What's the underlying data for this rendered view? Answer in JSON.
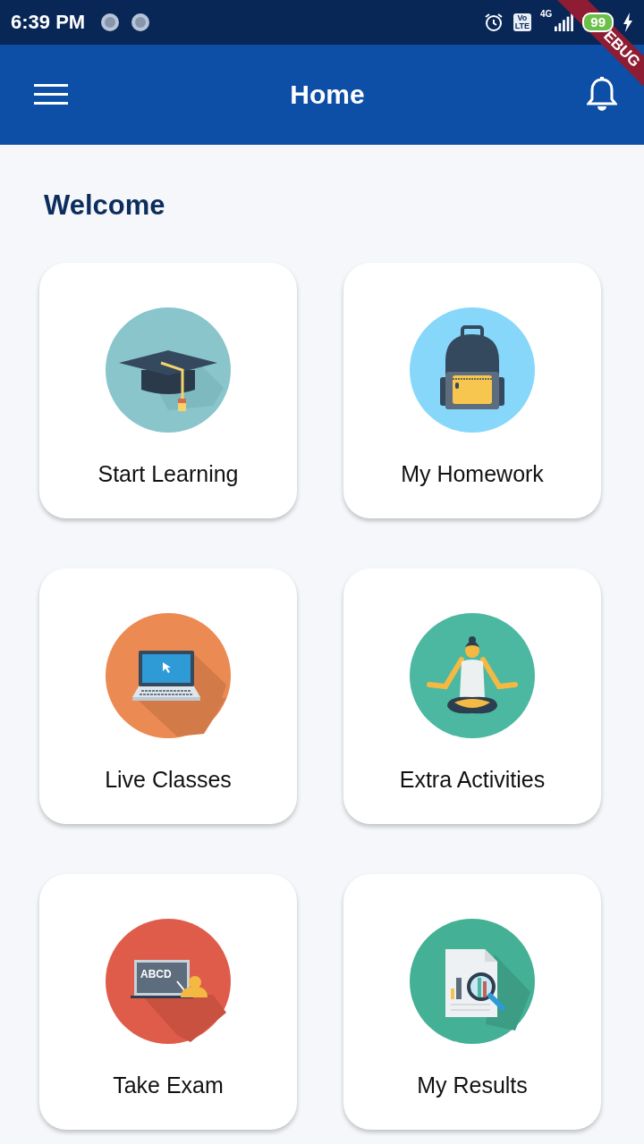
{
  "status_bar": {
    "time": "6:39 PM",
    "volte": [
      "Vo",
      "LTE"
    ],
    "network": "4G",
    "battery": "99",
    "banner": "EBUG"
  },
  "app_bar": {
    "title": "Home"
  },
  "welcome": "Welcome",
  "tiles": [
    {
      "label": "Start Learning",
      "kind": "graduation",
      "color": "#8ac5cc"
    },
    {
      "label": "My Homework",
      "kind": "backpack",
      "color": "#87d7fb"
    },
    {
      "label": "Live Classes",
      "kind": "laptop",
      "color": "#eb8a52"
    },
    {
      "label": "Extra Activities",
      "kind": "yoga",
      "color": "#4cb8a2"
    },
    {
      "label": "Take Exam",
      "kind": "board",
      "color": "#e05c4a",
      "board_text": "ABCD"
    },
    {
      "label": "My Results",
      "kind": "report",
      "color": "#44b095"
    }
  ]
}
